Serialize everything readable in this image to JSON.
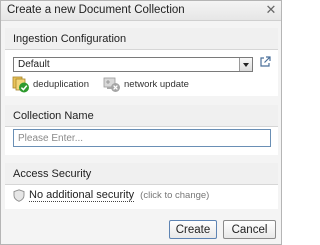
{
  "dialog": {
    "title": "Create a new Document Collection",
    "close_icon": "close-icon"
  },
  "ingestion": {
    "heading": "Ingestion Configuration",
    "selected": "Default",
    "external_icon": "external-link-icon",
    "features": [
      {
        "label": "deduplication",
        "icon": "deduplication-check-icon"
      },
      {
        "label": "network update",
        "icon": "network-update-disabled-icon"
      }
    ]
  },
  "collection": {
    "heading": "Collection Name",
    "value": "",
    "placeholder": "Please Enter..."
  },
  "access": {
    "heading": "Access Security",
    "value": "No additional security",
    "hint": "(click to change)",
    "icon": "shield-icon"
  },
  "buttons": {
    "create": "Create",
    "cancel": "Cancel"
  },
  "colors": {
    "input_border": "#6a8fb5",
    "check_green": "#2e9a2e"
  }
}
